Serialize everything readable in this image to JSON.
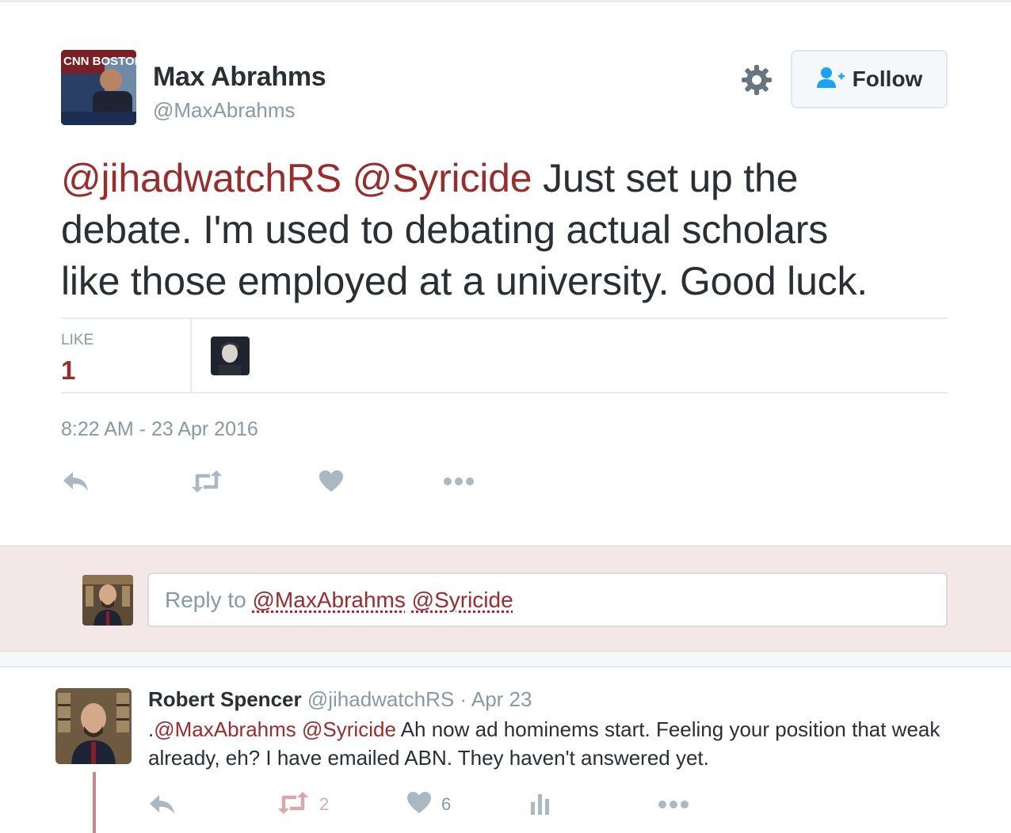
{
  "tweet": {
    "author_name": "Max Abrahms",
    "author_handle": "@MaxAbrahms",
    "follow_label": "Follow",
    "mention_1": "@jihadwatchRS",
    "mention_2": "@Syricide",
    "body_line_1_rest": " Just set up the",
    "body_line_2": "debate. I'm used to debating actual scholars",
    "body_line_3": "like those employed at a university. Good luck.",
    "like_label": "LIKE",
    "like_count": "1",
    "timestamp": "8:22 AM - 23 Apr 2016",
    "avatar_overlay_text": "CNN BOSTON"
  },
  "reply_box": {
    "prefix": "Reply to ",
    "mention_1": "@MaxAbrahms",
    "mention_2": "@Syricide"
  },
  "reply_tweet": {
    "author_name": "Robert Spencer",
    "meta": " @jihadwatchRS · Apr 23",
    "lead": ".",
    "mention_1": "@MaxAbrahms",
    "mention_2": "@Syricide",
    "body": " Ah now ad hominems start. Feeling your position that weak already, eh? I have emailed ABN. They haven't answered yet.",
    "retweet_count": "2",
    "like_count": "6"
  },
  "icons": {
    "settings": "gear-icon",
    "follow": "add-user-icon",
    "reply": "reply-icon",
    "retweet": "retweet-icon",
    "like": "heart-icon",
    "more": "more-icon",
    "analytics": "analytics-icon"
  },
  "colors": {
    "mention": "#9b2c2c",
    "follow_icon": "#1da1f2",
    "muted": "#8899a6",
    "reply_bar_bg": "#f3e7e7",
    "thread_line": "#c7888a"
  }
}
